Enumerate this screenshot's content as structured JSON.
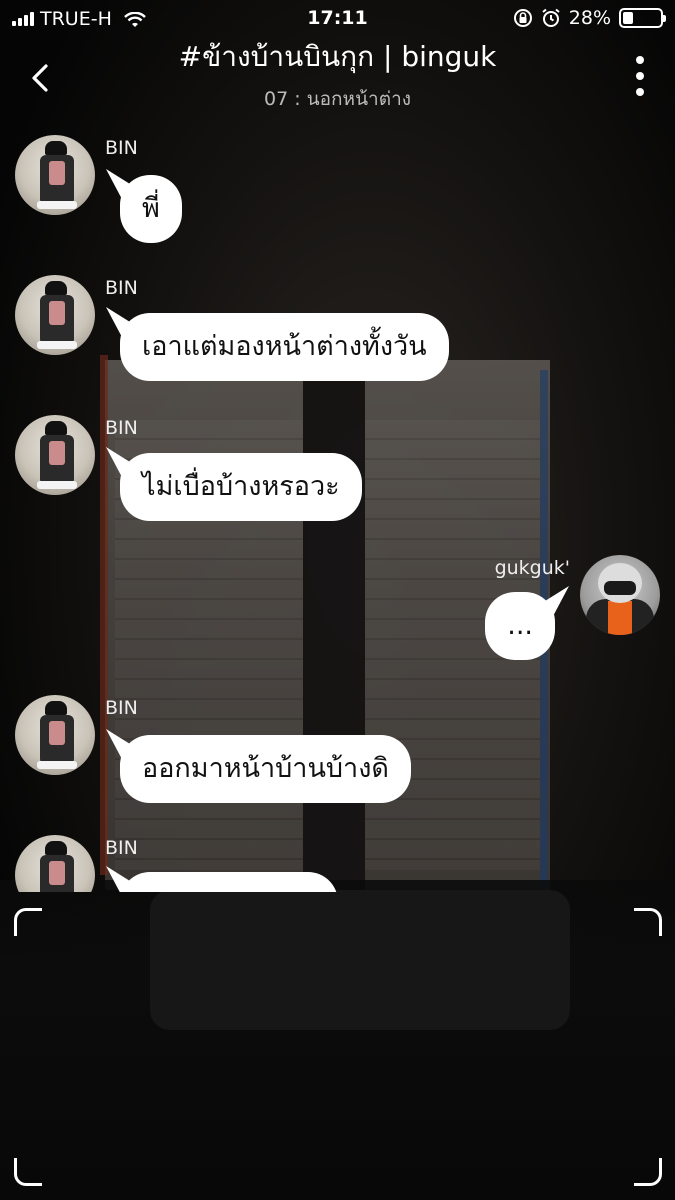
{
  "status_bar": {
    "carrier": "TRUE-H",
    "time": "17:11",
    "battery_percent": "28%",
    "battery_level": 0.28,
    "icons": [
      "signal-icon",
      "wifi-icon",
      "rotation-lock-icon",
      "alarm-icon",
      "battery-icon"
    ]
  },
  "header": {
    "title": "#ข้างบ้านบินกุก | binguk",
    "subtitle": "07 : นอกหน้าต่าง",
    "back_icon": "chevron-left-icon",
    "more_icon": "more-vertical-icon"
  },
  "messages": [
    {
      "sender": "BIN",
      "text": "พี่",
      "direction": "in"
    },
    {
      "sender": "BIN",
      "text": "เอาแต่มองหน้าต่างทั้งวัน",
      "direction": "in"
    },
    {
      "sender": "BIN",
      "text": "ไม่เบื่อบ้างหรอวะ",
      "direction": "in"
    },
    {
      "sender": "gukguk'",
      "text": "...",
      "direction": "out"
    },
    {
      "sender": "BIN",
      "text": "ออกมาหน้าบ้านบ้างดิ",
      "direction": "in"
    },
    {
      "sender": "BIN",
      "text": "",
      "direction": "in"
    }
  ],
  "colors": {
    "bubble": "#ffffff",
    "background": "#000000",
    "text_on_bubble": "#111111"
  }
}
